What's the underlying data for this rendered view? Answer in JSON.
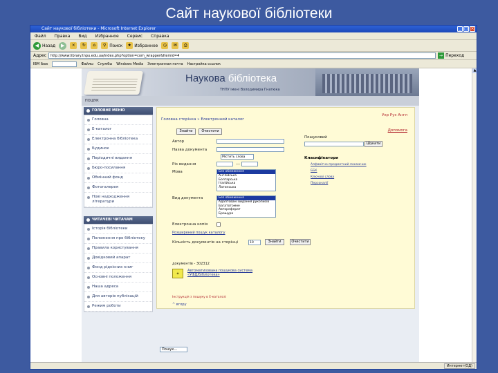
{
  "slide_title": "Сайт наукової бібліотеки",
  "window": {
    "title": "Сайт наукової бібліотеки - Microsoft Internet Explorer",
    "menu": [
      "Файл",
      "Правка",
      "Вид",
      "Избранное",
      "Сервис",
      "Справка"
    ],
    "toolbar": {
      "back": "Назад",
      "search": "Поиск",
      "favorites": "Избранное"
    },
    "address_label": "Адрес",
    "address_value": "http://www.library.tnpu.edu.ua/index.php?option=com_wrapper&Itemid=4",
    "go_label": "Переход",
    "links": [
      "IBM Ibox",
      "Файлы",
      "Службы",
      "Windows Media",
      "Электронная почта",
      "Настройка ссылок"
    ],
    "status_zone": "Интернет(ОД)"
  },
  "site": {
    "brand_dark": "Наукова ",
    "brand_light": "бібліотека",
    "brand_sub": "ТНПУ імені Володимира Гнатюка",
    "search_label": "ПОШУК"
  },
  "menu_main": {
    "heading": "ГОЛОВНЕ МЕНЮ",
    "items": [
      "Головна",
      "Е-каталог",
      "Електронна бібліотека",
      "Будинок",
      "Періодичні видання",
      "Бюро-посилання",
      "Обмінний фонд",
      "Фотогалерея",
      "Нові надходження літератури"
    ]
  },
  "menu_reader": {
    "heading": "ЧИТАЧЕВІ ЧИТАЧАМ",
    "items": [
      "Історія бібліотеки",
      "Положення про бібліотеку",
      "Правила користування",
      "Довідковий апарат",
      "Фонд рідкісних книг",
      "Основні положення",
      "Наша адреса",
      "Для авторів публікацій",
      "Режим роботи"
    ]
  },
  "catalog": {
    "crumb": "Головна сторінка » Електронний каталог",
    "lang": "Укр Рус Англ",
    "help": "Допомога",
    "btn_search": "Знайти",
    "btn_clear": "Очистити",
    "label_author": "Автор",
    "label_title": "Назва документа",
    "label_year": "Рік видання",
    "label_lang": "Мова",
    "label_doctype": "Вид документа",
    "label_ecopy": "Електронна копія",
    "match_value": "Містить слова",
    "year_dash": "---",
    "lang_options": [
      "Без обмеження",
      "Англійська",
      "Болгарська",
      "Італійська",
      "Латинська"
    ],
    "doctype_options": [
      "Без обмеження",
      "Адаптовані видання рукописів",
      "Багатотомне",
      "Автореферат",
      "Брошура"
    ],
    "hint_label": "Пошуковий",
    "hint_btn": "Шукати",
    "class_head": "Класифікатори",
    "class_links": [
      "Алфавітно-предметний покажчик",
      "ББК",
      "Ключові слова",
      "Персоналії"
    ],
    "ext_search": "Розширений пошук каталогу",
    "count_label": "Кількість документів на сторінці",
    "count_value": "10",
    "btn_find": "Знайти",
    "btn_clear2": "Очистити",
    "doc_count": "документів - 302312",
    "logo_text": "Автоматизована пошукова система «УФД/Бібліотека»",
    "footer_note": "Інструкція з пошуку в Е-каталозі",
    "up_link": "^ вгору"
  },
  "bottom_search": {
    "label": "",
    "value": "Пошук..."
  }
}
